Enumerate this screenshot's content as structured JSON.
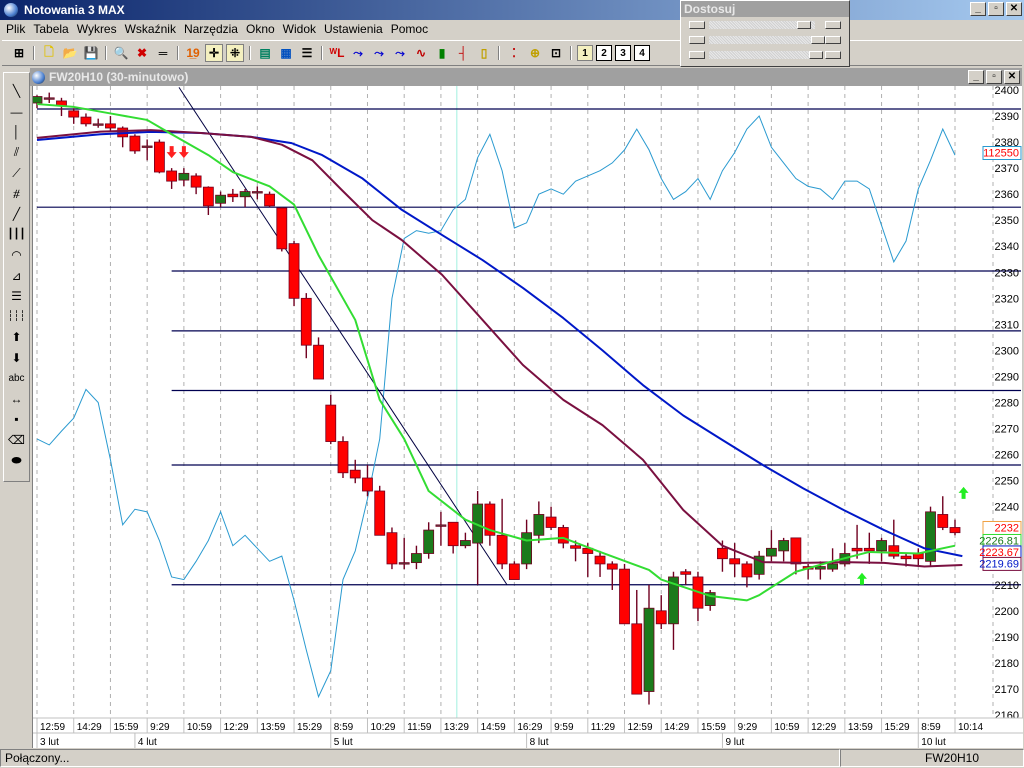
{
  "app": {
    "title": "Notowania 3 MAX"
  },
  "window_buttons": [
    "_",
    "▫",
    "✕"
  ],
  "menu": [
    "Plik",
    "Tabela",
    "Wykres",
    "Wskaźnik",
    "Narzędzia",
    "Okno",
    "Widok",
    "Ustawienia",
    "Pomoc"
  ],
  "toolbar": [
    {
      "name": "grid-icon",
      "glyph": "⊞"
    },
    {
      "sep": true
    },
    {
      "name": "new-file-icon",
      "glyph": "🗋"
    },
    {
      "name": "open-folder-icon",
      "glyph": "📂"
    },
    {
      "name": "save-icon",
      "glyph": "💾"
    },
    {
      "sep": true
    },
    {
      "name": "zoom-icon",
      "glyph": "🔍"
    },
    {
      "name": "delete-icon",
      "glyph": "✖"
    },
    {
      "name": "ruler-icon",
      "glyph": "═"
    },
    {
      "sep": true
    },
    {
      "name": "numbers-icon",
      "glyph": "1̲9"
    },
    {
      "name": "crosshair-icon",
      "glyph": "✛",
      "sel": true
    },
    {
      "name": "crosshair-dots-icon",
      "glyph": "⁜",
      "sel": true
    },
    {
      "sep": true
    },
    {
      "name": "table-icon",
      "glyph": "▤"
    },
    {
      "name": "layout-icon",
      "glyph": "▦"
    },
    {
      "name": "list-icon",
      "glyph": "☰"
    },
    {
      "sep": true
    },
    {
      "name": "wl-icon",
      "glyph": "ᵂL"
    },
    {
      "name": "wave-icon-1",
      "glyph": "⤳"
    },
    {
      "name": "wave-icon-2",
      "glyph": "⤳"
    },
    {
      "name": "wave-icon-3",
      "glyph": "⤳"
    },
    {
      "name": "line-chart-icon",
      "glyph": "∿"
    },
    {
      "name": "bar-chart-icon",
      "glyph": "▮"
    },
    {
      "name": "ohlc-icon",
      "glyph": "┤"
    },
    {
      "name": "candlestick-icon",
      "glyph": "▯"
    },
    {
      "sep": true
    },
    {
      "name": "traffic-light-icon",
      "glyph": "⁚"
    },
    {
      "name": "add-indicator-icon",
      "glyph": "⊕"
    },
    {
      "name": "add-window-icon",
      "glyph": "⊡"
    },
    {
      "sep": true
    },
    {
      "name": "layout-1-button",
      "glyph": "1",
      "box": true,
      "sel": true
    },
    {
      "name": "layout-2-button",
      "glyph": "2",
      "box": true
    },
    {
      "name": "layout-3-button",
      "glyph": "3",
      "box": true
    },
    {
      "name": "layout-4-button",
      "glyph": "4",
      "box": true
    }
  ],
  "adjust_panel": {
    "title": "Dostosuj"
  },
  "chart_window": {
    "title": "FW20H10 (30-minutowo)"
  },
  "left_tools": [
    {
      "name": "diagonal-line-tool-icon",
      "glyph": "╲"
    },
    {
      "name": "horizontal-line-tool-icon",
      "glyph": "—"
    },
    {
      "name": "vertical-line-tool-icon",
      "glyph": "│"
    },
    {
      "name": "channel-tool-icon",
      "glyph": "⫽"
    },
    {
      "name": "fan-tool-icon",
      "glyph": "⟋"
    },
    {
      "name": "gann-tool-icon",
      "glyph": "⧣"
    },
    {
      "name": "trendline-tool-icon",
      "glyph": "╱"
    },
    {
      "name": "cycle-lines-tool-icon",
      "glyph": "┃┃┃"
    },
    {
      "name": "arcs-tool-icon",
      "glyph": "◠"
    },
    {
      "name": "speed-lines-tool-icon",
      "glyph": "⊿"
    },
    {
      "name": "fibonacci-tool-icon",
      "glyph": "☰"
    },
    {
      "name": "time-zones-tool-icon",
      "glyph": "┆┆┆"
    },
    {
      "name": "up-arrow-tool-icon",
      "glyph": "⬆"
    },
    {
      "name": "down-arrow-tool-icon",
      "glyph": "⬇"
    },
    {
      "name": "text-tool-icon",
      "glyph": "abc"
    },
    {
      "name": "move-tool-icon",
      "glyph": "↔"
    },
    {
      "name": "point-tool-icon",
      "glyph": "▪"
    },
    {
      "name": "eraser-tool-icon",
      "glyph": "⌫"
    },
    {
      "name": "eraser-all-tool-icon",
      "glyph": "⬬"
    }
  ],
  "colors": {
    "up": "#1b7a1b",
    "down": "#ff0000",
    "ma_fast": "#33dd33",
    "ma_mid": "#7a1040",
    "ma_slow": "#0018c8",
    "oscillator": "#2a9ad0",
    "trend": "#000040"
  },
  "chart_data": {
    "type": "candlestick",
    "symbol": "FW20H10",
    "interval": "30-minutowo",
    "ylim": [
      2160,
      2400
    ],
    "yticks": [
      2160,
      2170,
      2180,
      2190,
      2200,
      2210,
      2220,
      2230,
      2240,
      2250,
      2260,
      2270,
      2280,
      2290,
      2300,
      2310,
      2320,
      2330,
      2340,
      2350,
      2360,
      2370,
      2380,
      2390,
      2400
    ],
    "time_labels": [
      "12:59",
      "14:29",
      "15:59",
      "9:29",
      "10:59",
      "12:29",
      "13:59",
      "15:29",
      "8:59",
      "10:29",
      "11:59",
      "13:29",
      "14:59",
      "16:29",
      "9:59",
      "11:29",
      "12:59",
      "14:29",
      "15:59",
      "9:29",
      "10:59",
      "12:29",
      "13:59",
      "15:29",
      "8:59",
      "10:14"
    ],
    "time_label_every": 3,
    "date_labels": [
      {
        "label": "3 lut",
        "index": 0
      },
      {
        "label": "4 lut",
        "index": 8
      },
      {
        "label": "5 lut",
        "index": 24
      },
      {
        "label": "8 lut",
        "index": 40
      },
      {
        "label": "9 lut",
        "index": 56
      },
      {
        "label": "10 lut",
        "index": 72
      }
    ],
    "candles": [
      [
        2395,
        2398,
        2393,
        2397.5
      ],
      [
        2397,
        2399,
        2395,
        2397
      ],
      [
        2395.8,
        2397,
        2390,
        2393.9
      ],
      [
        2392,
        2393,
        2387,
        2389.6
      ],
      [
        2389.6,
        2391,
        2386,
        2387
      ],
      [
        2387,
        2389,
        2385.5,
        2387
      ],
      [
        2387,
        2390,
        2384,
        2385.4
      ],
      [
        2385.4,
        2386,
        2378,
        2382
      ],
      [
        2382.3,
        2383,
        2375.5,
        2376.6
      ],
      [
        2378.5,
        2381,
        2373,
        2378.5
      ],
      [
        2380,
        2381,
        2368,
        2368.5
      ],
      [
        2368.9,
        2370,
        2362,
        2365
      ],
      [
        2365.4,
        2370,
        2363,
        2368
      ],
      [
        2367,
        2368,
        2360,
        2362.7
      ],
      [
        2362.7,
        2363,
        2352,
        2355.5
      ],
      [
        2356.5,
        2361,
        2355,
        2359.6
      ],
      [
        2360,
        2362,
        2357,
        2359
      ],
      [
        2359,
        2362,
        2355,
        2361
      ],
      [
        2361,
        2363,
        2358,
        2361
      ],
      [
        2360,
        2361,
        2355,
        2355.5
      ],
      [
        2354.7,
        2355,
        2338,
        2339
      ],
      [
        2341,
        2342,
        2317,
        2320
      ],
      [
        2320,
        2322,
        2297,
        2302
      ],
      [
        2302,
        2305,
        2289,
        2289
      ],
      [
        2279,
        2283,
        2264,
        2265
      ],
      [
        2265,
        2267,
        2251,
        2253
      ],
      [
        2254,
        2258,
        2249,
        2251
      ],
      [
        2251,
        2256,
        2244,
        2246
      ],
      [
        2246,
        2248,
        2229,
        2229
      ],
      [
        2230,
        2232,
        2216,
        2218
      ],
      [
        2218.5,
        2228,
        2216,
        2218.5
      ],
      [
        2218.5,
        2225,
        2216,
        2222
      ],
      [
        2222,
        2234,
        2220,
        2231
      ],
      [
        2233,
        2238,
        2225,
        2233
      ],
      [
        2234,
        2234,
        2222,
        2225
      ],
      [
        2225,
        2230,
        2224,
        2227
      ],
      [
        2226,
        2246,
        2210,
        2241
      ],
      [
        2241,
        2242,
        2225,
        2229
      ],
      [
        2229,
        2243,
        2216,
        2218
      ],
      [
        2218,
        2219,
        2212,
        2212
      ],
      [
        2218,
        2235,
        2216,
        2230
      ],
      [
        2229,
        2242,
        2226,
        2237
      ],
      [
        2236,
        2240,
        2231,
        2232
      ],
      [
        2232,
        2233,
        2224,
        2226
      ],
      [
        2225,
        2227,
        2219,
        2224
      ],
      [
        2224,
        2226,
        2213,
        2222
      ],
      [
        2221,
        2223,
        2213,
        2218
      ],
      [
        2218,
        2219,
        2208,
        2216
      ],
      [
        2216,
        2218,
        2195,
        2195
      ],
      [
        2195,
        2208,
        2168,
        2168
      ],
      [
        2169,
        2210,
        2164,
        2201
      ],
      [
        2200,
        2206,
        2193,
        2195
      ],
      [
        2195,
        2215,
        2185,
        2213
      ],
      [
        2215,
        2216,
        2210,
        2214
      ],
      [
        2213,
        2215,
        2196,
        2201
      ],
      [
        2202,
        2208,
        2200,
        2207
      ],
      [
        2224,
        2227,
        2215,
        2220
      ],
      [
        2220,
        2226,
        2213,
        2218
      ],
      [
        2218,
        2219,
        2209,
        2213
      ],
      [
        2214,
        2223,
        2212,
        2221
      ],
      [
        2221,
        2231,
        2219,
        2224
      ],
      [
        2223,
        2228,
        2219,
        2227
      ],
      [
        2228,
        2228,
        2214,
        2218
      ],
      [
        2217,
        2218,
        2212,
        2216
      ],
      [
        2216,
        2219,
        2212,
        2217
      ],
      [
        2216,
        2224,
        2215,
        2218
      ],
      [
        2218,
        2226,
        2217,
        2222
      ],
      [
        2224,
        2233,
        2220,
        2223
      ],
      [
        2224,
        2230,
        2218,
        2223
      ],
      [
        2223,
        2228,
        2219,
        2227
      ],
      [
        2225,
        2235,
        2220,
        2221
      ],
      [
        2221,
        2222,
        2217,
        2220
      ],
      [
        2222,
        2224,
        2217,
        2220
      ],
      [
        2219,
        2240,
        2217,
        2238
      ],
      [
        2237,
        2244,
        2231,
        2232
      ],
      [
        2232,
        2235,
        2229,
        2230
      ]
    ],
    "ma_fast": [
      [
        0,
        2394.6
      ],
      [
        3,
        2393.5
      ],
      [
        6,
        2391
      ],
      [
        9,
        2388.5
      ],
      [
        11,
        2383
      ],
      [
        14,
        2375
      ],
      [
        16,
        2368.5
      ],
      [
        19,
        2363
      ],
      [
        21,
        2356
      ],
      [
        23,
        2336.6
      ],
      [
        26,
        2311.7
      ],
      [
        28,
        2281
      ],
      [
        30,
        2266
      ],
      [
        32,
        2246
      ],
      [
        35,
        2235
      ],
      [
        37,
        2231
      ],
      [
        40,
        2227
      ],
      [
        43,
        2228
      ],
      [
        46,
        2222.6
      ],
      [
        50,
        2215.7
      ],
      [
        51,
        2212
      ],
      [
        55,
        2205.7
      ],
      [
        58,
        2204
      ],
      [
        59,
        2206
      ],
      [
        62,
        2215
      ],
      [
        65,
        2219
      ],
      [
        68,
        2222.6
      ],
      [
        72,
        2222
      ],
      [
        75,
        2225
      ]
    ],
    "ma_mid": [
      [
        0,
        2381.6
      ],
      [
        5.2,
        2384
      ],
      [
        9.3,
        2384.6
      ],
      [
        13.4,
        2383.5
      ],
      [
        17.5,
        2382
      ],
      [
        20,
        2379
      ],
      [
        22.5,
        2373
      ],
      [
        24.9,
        2361.6
      ],
      [
        27.4,
        2350
      ],
      [
        29.8,
        2342.4
      ],
      [
        33.1,
        2329
      ],
      [
        36.4,
        2311.7
      ],
      [
        39.7,
        2294.4
      ],
      [
        43,
        2281
      ],
      [
        46.2,
        2271.3
      ],
      [
        49.5,
        2258
      ],
      [
        52.8,
        2238.7
      ],
      [
        56,
        2225
      ],
      [
        59.3,
        2218.7
      ],
      [
        62.6,
        2218.4
      ],
      [
        65.9,
        2218.7
      ],
      [
        69.2,
        2218.4
      ],
      [
        72.5,
        2217
      ],
      [
        75.6,
        2217.6
      ]
    ],
    "ma_slow": [
      [
        0,
        2380.8
      ],
      [
        5.2,
        2383
      ],
      [
        9.3,
        2383.9
      ],
      [
        13.4,
        2383.5
      ],
      [
        17.5,
        2382
      ],
      [
        20.8,
        2379.6
      ],
      [
        23.3,
        2375
      ],
      [
        26.6,
        2366
      ],
      [
        29.8,
        2354
      ],
      [
        33.1,
        2344.3
      ],
      [
        36.4,
        2334.7
      ],
      [
        39.7,
        2324
      ],
      [
        43,
        2312.4
      ],
      [
        46.2,
        2300
      ],
      [
        49.5,
        2286.7
      ],
      [
        52.8,
        2275
      ],
      [
        56,
        2265.6
      ],
      [
        59.3,
        2256
      ],
      [
        62.6,
        2247
      ],
      [
        65.9,
        2238.7
      ],
      [
        69.2,
        2231
      ],
      [
        72.5,
        2224
      ],
      [
        75.6,
        2221
      ]
    ],
    "oscillator": [
      2266,
      2263.7,
      2269,
      2274,
      2285,
      2280,
      2258,
      2233,
      2239,
      2238,
      2227,
      2213,
      2212,
      2219,
      2227,
      2238,
      2225,
      2229,
      2224,
      2219,
      2221,
      2204,
      2185,
      2167,
      2177,
      2212,
      2223,
      2243,
      2266,
      2320,
      2343,
      2346,
      2345,
      2346,
      2354,
      2358,
      2374,
      2383,
      2369,
      2347,
      2349,
      2360,
      2362,
      2360,
      2365,
      2367,
      2369,
      2372,
      2377,
      2385,
      2377,
      2366,
      2358,
      2361,
      2366,
      2358,
      2369,
      2376,
      2385,
      2390,
      2378,
      2372,
      2366,
      2363,
      2362,
      2358,
      2365,
      2365,
      2362,
      2348,
      2334,
      2342,
      2362,
      2373,
      2385,
      2375
    ],
    "horizontal_lines": [
      {
        "price": 2392.7,
        "from": 0
      },
      {
        "price": 2355,
        "from": 0
      },
      {
        "price": 2330.5,
        "from": 11
      },
      {
        "price": 2307.5,
        "from": 11
      },
      {
        "price": 2284.6,
        "from": 11
      },
      {
        "price": 2256,
        "from": 11
      },
      {
        "price": 2210,
        "from": 11
      }
    ],
    "trendline": [
      [
        11.6,
        2401
      ],
      [
        38.4,
        2210
      ]
    ],
    "cursor_index": 34.3,
    "sell_signals": [
      11,
      12
    ],
    "buy_signals": [
      {
        "index": 67.4,
        "price": 2210
      },
      {
        "index": 75.7,
        "price": 2243
      }
    ],
    "price_labels": [
      {
        "text": "112550",
        "price": 2376,
        "color": "#ff0000",
        "border": "#2a9ad0"
      },
      {
        "text": "2232",
        "price": 2232,
        "color": "#ff0000",
        "border": "#f0a040"
      },
      {
        "text": "2226.81",
        "price": 2227,
        "color": "#1b7a1b",
        "border": "#33dd33"
      },
      {
        "text": "2223.67",
        "price": 2222.6,
        "color": "#ff0000",
        "border": "#0018c8"
      },
      {
        "text": "2219.69",
        "price": 2218.2,
        "color": "#0018c8",
        "border": "#7a1040"
      }
    ]
  },
  "status": {
    "left": "Połączony...",
    "right": "FW20H10"
  }
}
